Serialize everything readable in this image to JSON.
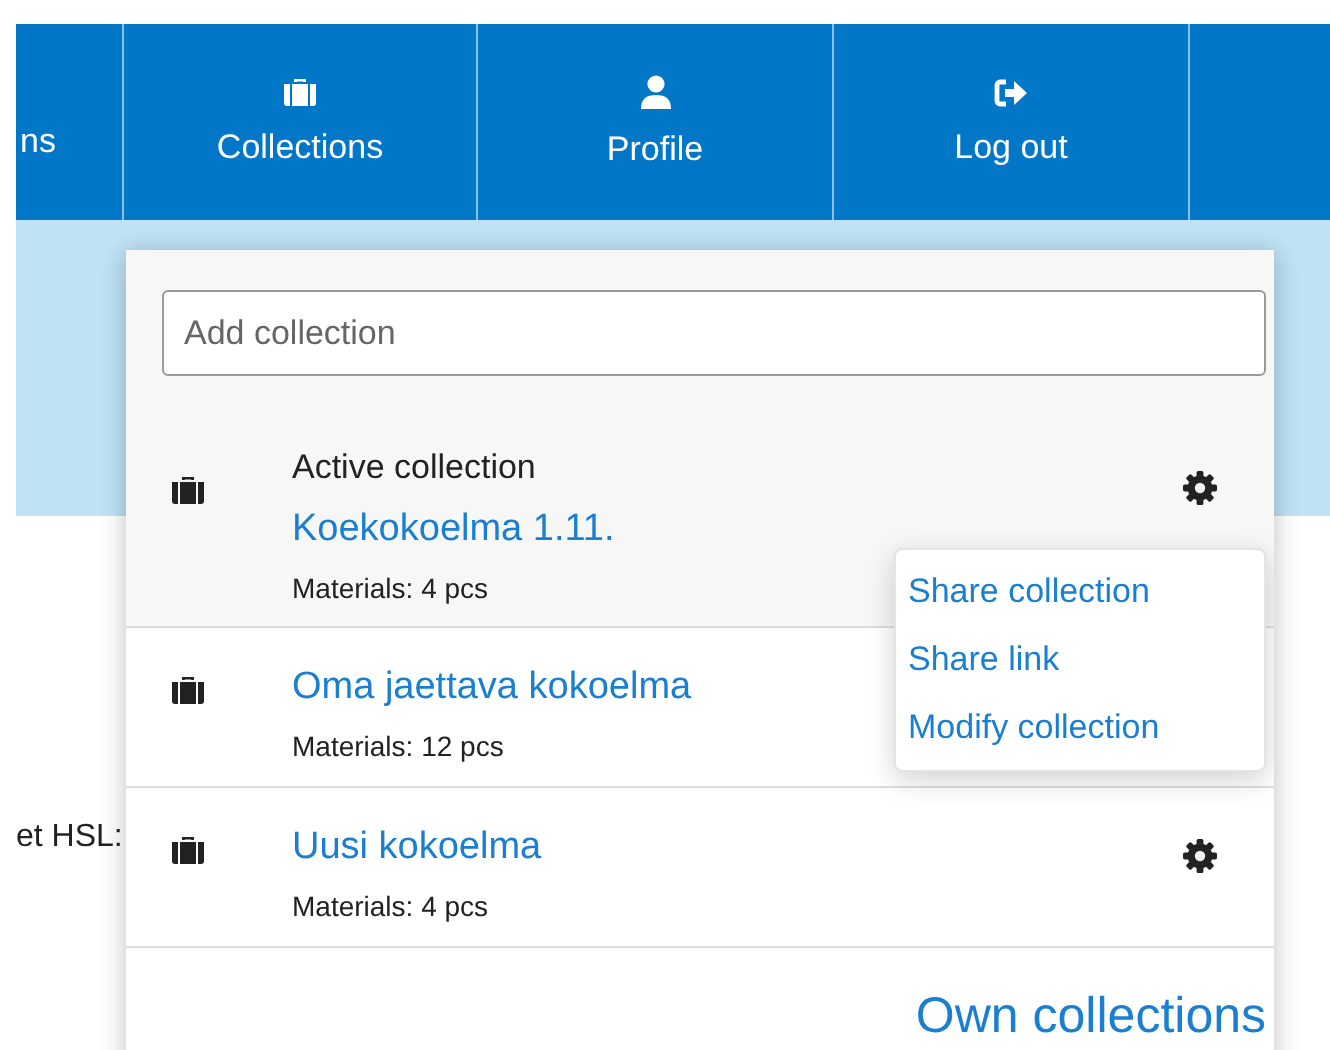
{
  "nav": {
    "items": [
      {
        "kind": "partial",
        "label": "ns"
      },
      {
        "kind": "collections",
        "label": "Collections"
      },
      {
        "kind": "profile",
        "label": "Profile"
      },
      {
        "kind": "logout",
        "label": "Log out"
      },
      {
        "kind": "blank"
      }
    ]
  },
  "background_text": "et HSL:",
  "dropdown": {
    "search": {
      "placeholder": "Add collection"
    },
    "active_label": "Active collection",
    "collections": [
      {
        "name": "Koekokoelma 1.11.",
        "materials": "Materials: 4 pcs",
        "active": true,
        "menu_open": true
      },
      {
        "name": "Oma jaettava kokoelma",
        "materials": "Materials: 12 pcs",
        "active": false,
        "menu_open": false
      },
      {
        "name": "Uusi kokoelma",
        "materials": "Materials: 4 pcs",
        "active": false,
        "menu_open": false
      }
    ],
    "menu": [
      "Share collection",
      "Share link",
      "Modify collection"
    ],
    "footer_link": "Own collections"
  }
}
